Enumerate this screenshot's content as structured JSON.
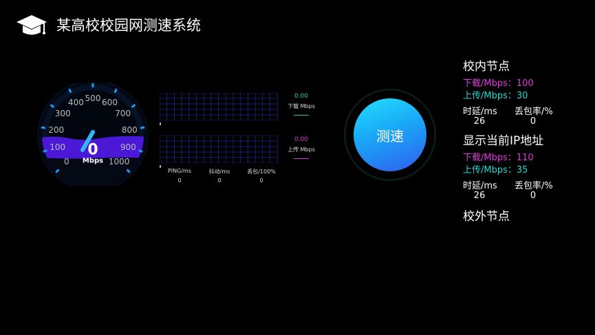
{
  "app": {
    "title": "某高校校园网测速系统"
  },
  "gauge": {
    "scale_labels": [
      "0",
      "100",
      "200",
      "300",
      "400",
      "500",
      "600",
      "700",
      "800",
      "900",
      "1000"
    ],
    "value": "0",
    "unit": "Mbps"
  },
  "graphs": {
    "download": {
      "value": "0.00",
      "label": "下载 Mbps",
      "color": "#24c9b6"
    },
    "upload": {
      "value": "0.00",
      "label": "上传 Mbps",
      "color": "#d63ad8"
    }
  },
  "stats": {
    "ping": {
      "label": "PING/ms",
      "value": "0"
    },
    "jitter": {
      "label": "抖动/ms",
      "value": "0"
    },
    "loss": {
      "label": "丢包/100%",
      "value": "0"
    }
  },
  "test_button": {
    "label": "测速"
  },
  "panel": {
    "sections": [
      {
        "title": "校内节点",
        "download": "下载/Mbps：100",
        "upload": "上传/Mbps：30",
        "latency_label": "时延/ms",
        "latency_value": "26",
        "loss_label": "丢包率/%",
        "loss_value": "0"
      },
      {
        "title": "显示当前IP地址",
        "download": "下载/Mbps：110",
        "upload": "上传/Mbps：35",
        "latency_label": "时延/ms",
        "latency_value": "26",
        "loss_label": "丢包率/%",
        "loss_value": "0"
      },
      {
        "title": "校外节点"
      }
    ]
  },
  "colors": {
    "download": "#e23be0",
    "upload": "#25d8d0",
    "gauge_fill": "#4b18d8",
    "gauge_ticks": "#1a9cf0"
  },
  "icons": {
    "logo": "graduation-cap-icon"
  }
}
